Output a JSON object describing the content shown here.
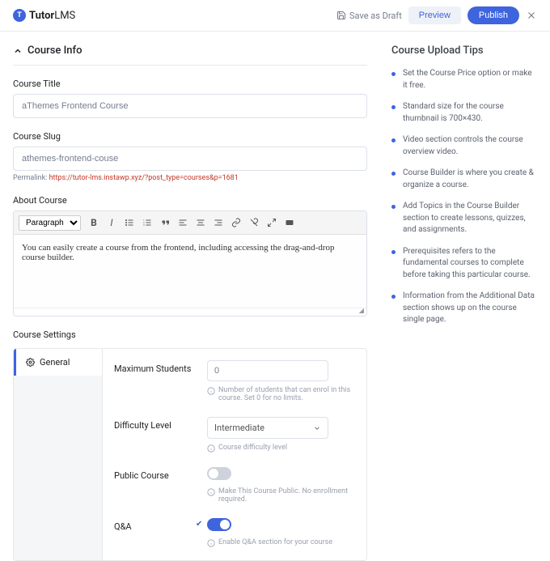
{
  "brand": {
    "name_a": "Tutor",
    "name_b": "LMS"
  },
  "topbar": {
    "save_draft": "Save as Draft",
    "preview": "Preview",
    "publish": "Publish"
  },
  "section": "Course Info",
  "course_title": {
    "label": "Course Title",
    "value": "aThemes Frontend Course"
  },
  "course_slug": {
    "label": "Course Slug",
    "value": "athemes-frontend-couse"
  },
  "permalink": {
    "label": "Permalink:",
    "url": "https://tutor-lms.instawp.xyz/?post_type=courses&p=1681"
  },
  "about": {
    "label": "About Course",
    "format": "Paragraph",
    "content": "You can easily create a course from the frontend, including accessing the drag-and-drop course builder."
  },
  "settings": {
    "title": "Course Settings",
    "tab_general": "General",
    "max_students": {
      "label": "Maximum Students",
      "value": "0",
      "help": "Number of students that can enrol in this course. Set 0 for no limits."
    },
    "difficulty": {
      "label": "Difficulty Level",
      "value": "Intermediate",
      "help": "Course difficulty level"
    },
    "public_course": {
      "label": "Public Course",
      "help": "Make This Course Public. No enrollment required."
    },
    "qa": {
      "label": "Q&A",
      "help": "Enable Q&A section for your course"
    }
  },
  "tips": {
    "title": "Course Upload Tips",
    "items": [
      "Set the Course Price option or make it free.",
      "Standard size for the course thumbnail is 700×430.",
      "Video section controls the course overview video.",
      "Course Builder is where you create & organize a course.",
      "Add Topics in the Course Builder section to create lessons, quizzes, and assignments.",
      "Prerequisites refers to the fundamental courses to complete before taking this particular course.",
      "Information from the Additional Data section shows up on the course single page."
    ]
  }
}
